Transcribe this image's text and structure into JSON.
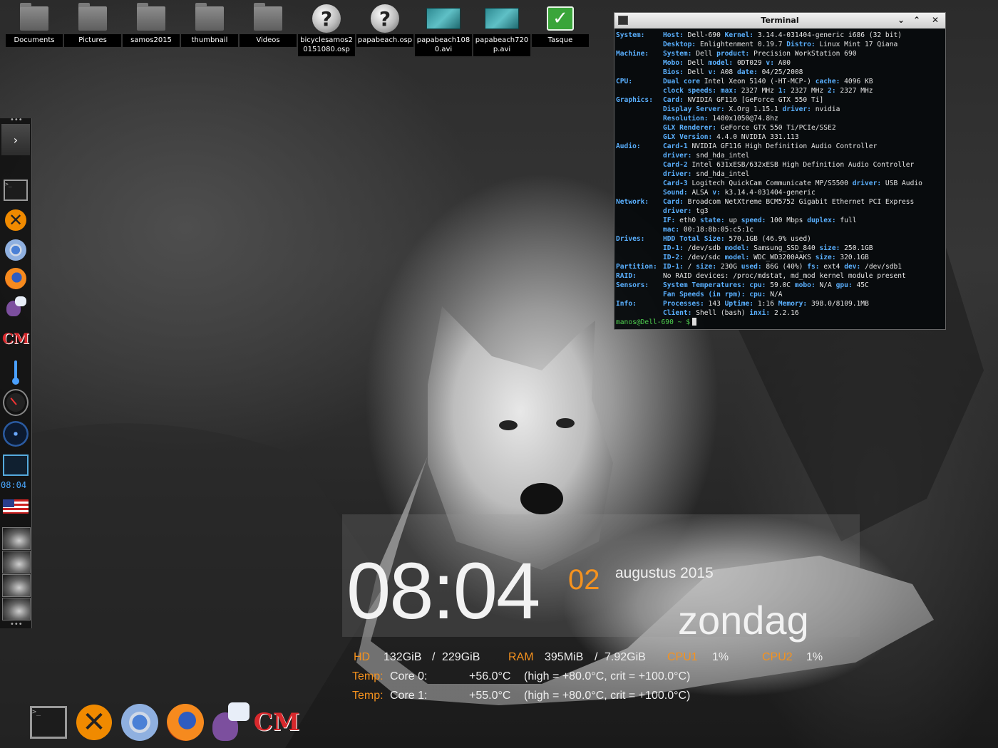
{
  "desktop_icons": [
    {
      "label": "Documents",
      "icon": "folder-icon"
    },
    {
      "label": "Pictures",
      "icon": "folder-icon"
    },
    {
      "label": "samos2015",
      "icon": "folder-icon"
    },
    {
      "label": "thumbnail",
      "icon": "folder-icon"
    },
    {
      "label": "Videos",
      "icon": "folder-icon"
    },
    {
      "label": "bicyclesamos20151080.osp",
      "icon": "unknown-file-icon"
    },
    {
      "label": "papabeach.osp",
      "icon": "unknown-file-icon"
    },
    {
      "label": "papabeach1080.avi",
      "icon": "video-file-icon"
    },
    {
      "label": "papabeach720p.avi",
      "icon": "video-file-icon"
    },
    {
      "label": "Tasque",
      "icon": "checkmark-icon"
    }
  ],
  "shelf": {
    "toggle_glyph": "›",
    "clock_text": "08:04",
    "launchers": [
      "terminal-icon",
      "xo-icon",
      "chrome-icon",
      "firefox-icon",
      "pidgin-icon",
      "cm-icon"
    ],
    "gadgets": [
      "thermometer-icon",
      "speedometer-icon",
      "disc-icon",
      "screen-icon"
    ]
  },
  "terminal": {
    "title": "Terminal",
    "lines": [
      {
        "sec": "System:",
        "parts": [
          [
            "k",
            "Host: "
          ],
          [
            "t",
            "Dell-690 "
          ],
          [
            "k",
            "Kernel: "
          ],
          [
            "t",
            "3.14.4-031404-generic i686 (32 bit)"
          ]
        ]
      },
      {
        "sec": "",
        "parts": [
          [
            "k",
            "Desktop: "
          ],
          [
            "t",
            "Enlightenment 0.19.7 "
          ],
          [
            "k",
            "Distro: "
          ],
          [
            "t",
            "Linux Mint 17 Qiana"
          ]
        ]
      },
      {
        "sec": "Machine:",
        "parts": [
          [
            "k",
            "System: "
          ],
          [
            "t",
            "Dell "
          ],
          [
            "k",
            "product: "
          ],
          [
            "t",
            "Precision WorkStation 690"
          ]
        ]
      },
      {
        "sec": "",
        "parts": [
          [
            "k",
            "Mobo: "
          ],
          [
            "t",
            "Dell "
          ],
          [
            "k",
            "model: "
          ],
          [
            "t",
            "0DT029 "
          ],
          [
            "k",
            "v: "
          ],
          [
            "t",
            "A00"
          ]
        ]
      },
      {
        "sec": "",
        "parts": [
          [
            "k",
            "Bios: "
          ],
          [
            "t",
            "Dell "
          ],
          [
            "k",
            "v: "
          ],
          [
            "t",
            "A08 "
          ],
          [
            "k",
            "date: "
          ],
          [
            "t",
            "04/25/2008"
          ]
        ]
      },
      {
        "sec": "CPU:",
        "parts": [
          [
            "k",
            "Dual core "
          ],
          [
            "t",
            "Intel Xeon 5140 (-HT-MCP-) "
          ],
          [
            "k",
            "cache: "
          ],
          [
            "t",
            "4096 KB"
          ]
        ]
      },
      {
        "sec": "",
        "parts": [
          [
            "k",
            "clock speeds: max: "
          ],
          [
            "t",
            "2327 MHz "
          ],
          [
            "k",
            "1: "
          ],
          [
            "t",
            "2327 MHz "
          ],
          [
            "k",
            "2: "
          ],
          [
            "t",
            "2327 MHz"
          ]
        ]
      },
      {
        "sec": "Graphics:",
        "parts": [
          [
            "k",
            "Card: "
          ],
          [
            "t",
            "NVIDIA GF116 [GeForce GTX 550 Ti]"
          ]
        ]
      },
      {
        "sec": "",
        "parts": [
          [
            "k",
            "Display Server: "
          ],
          [
            "t",
            "X.Org 1.15.1 "
          ],
          [
            "k",
            "driver: "
          ],
          [
            "t",
            "nvidia"
          ]
        ]
      },
      {
        "sec": "",
        "parts": [
          [
            "k",
            "Resolution: "
          ],
          [
            "t",
            "1400x1050@74.8hz"
          ]
        ]
      },
      {
        "sec": "",
        "parts": [
          [
            "k",
            "GLX Renderer: "
          ],
          [
            "t",
            "GeForce GTX 550 Ti/PCIe/SSE2"
          ]
        ]
      },
      {
        "sec": "",
        "parts": [
          [
            "k",
            "GLX Version: "
          ],
          [
            "t",
            "4.4.0 NVIDIA 331.113"
          ]
        ]
      },
      {
        "sec": "Audio:",
        "parts": [
          [
            "k",
            "Card-1 "
          ],
          [
            "t",
            "NVIDIA GF116 High Definition Audio Controller"
          ]
        ]
      },
      {
        "sec": "",
        "parts": [
          [
            "k",
            "driver: "
          ],
          [
            "t",
            "snd_hda_intel"
          ]
        ]
      },
      {
        "sec": "",
        "parts": [
          [
            "k",
            "Card-2 "
          ],
          [
            "t",
            "Intel 631xESB/632xESB High Definition Audio Controller"
          ]
        ]
      },
      {
        "sec": "",
        "parts": [
          [
            "k",
            "driver: "
          ],
          [
            "t",
            "snd_hda_intel"
          ]
        ]
      },
      {
        "sec": "",
        "parts": [
          [
            "k",
            "Card-3 "
          ],
          [
            "t",
            "Logitech QuickCam Communicate MP/S5500 "
          ],
          [
            "k",
            "driver: "
          ],
          [
            "t",
            "USB Audio"
          ]
        ]
      },
      {
        "sec": "",
        "parts": [
          [
            "k",
            "Sound: "
          ],
          [
            "t",
            "ALSA "
          ],
          [
            "k",
            "v: "
          ],
          [
            "t",
            "k3.14.4-031404-generic"
          ]
        ]
      },
      {
        "sec": "Network:",
        "parts": [
          [
            "k",
            "Card: "
          ],
          [
            "t",
            "Broadcom NetXtreme BCM5752 Gigabit Ethernet PCI Express"
          ]
        ]
      },
      {
        "sec": "",
        "parts": [
          [
            "k",
            "driver: "
          ],
          [
            "t",
            "tg3"
          ]
        ]
      },
      {
        "sec": "",
        "parts": [
          [
            "k",
            "IF: "
          ],
          [
            "t",
            "eth0 "
          ],
          [
            "k",
            "state: "
          ],
          [
            "t",
            "up "
          ],
          [
            "k",
            "speed: "
          ],
          [
            "t",
            "100 Mbps "
          ],
          [
            "k",
            "duplex: "
          ],
          [
            "t",
            "full"
          ]
        ]
      },
      {
        "sec": "",
        "parts": [
          [
            "k",
            "mac: "
          ],
          [
            "t",
            "00:18:8b:05:c5:1c"
          ]
        ]
      },
      {
        "sec": "Drives:",
        "parts": [
          [
            "k",
            "HDD Total Size: "
          ],
          [
            "t",
            "570.1GB (46.9% used)"
          ]
        ]
      },
      {
        "sec": "",
        "parts": [
          [
            "k",
            "ID-1: "
          ],
          [
            "t",
            "/dev/sdb "
          ],
          [
            "k",
            "model: "
          ],
          [
            "t",
            "Samsung_SSD_840 "
          ],
          [
            "k",
            "size: "
          ],
          [
            "t",
            "250.1GB"
          ]
        ]
      },
      {
        "sec": "",
        "parts": [
          [
            "k",
            "ID-2: "
          ],
          [
            "t",
            "/dev/sdc "
          ],
          [
            "k",
            "model: "
          ],
          [
            "t",
            "WDC_WD3200AAKS "
          ],
          [
            "k",
            "size: "
          ],
          [
            "t",
            "320.1GB"
          ]
        ]
      },
      {
        "sec": "Partition:",
        "parts": [
          [
            "k",
            "ID-1: "
          ],
          [
            "t",
            "/ "
          ],
          [
            "k",
            "size: "
          ],
          [
            "t",
            "230G "
          ],
          [
            "k",
            "used: "
          ],
          [
            "t",
            "86G (40%) "
          ],
          [
            "k",
            "fs: "
          ],
          [
            "t",
            "ext4 "
          ],
          [
            "k",
            "dev: "
          ],
          [
            "t",
            "/dev/sdb1"
          ]
        ]
      },
      {
        "sec": "RAID:",
        "parts": [
          [
            "t",
            "No RAID devices: /proc/mdstat, md_mod kernel module present"
          ]
        ]
      },
      {
        "sec": "Sensors:",
        "parts": [
          [
            "k",
            "System Temperatures: cpu: "
          ],
          [
            "t",
            "59.0C "
          ],
          [
            "k",
            "mobo: "
          ],
          [
            "t",
            "N/A "
          ],
          [
            "k",
            "gpu: "
          ],
          [
            "t",
            "45C"
          ]
        ]
      },
      {
        "sec": "",
        "parts": [
          [
            "k",
            "Fan Speeds (in rpm): cpu: "
          ],
          [
            "t",
            "N/A"
          ]
        ]
      },
      {
        "sec": "Info:",
        "parts": [
          [
            "k",
            "Processes: "
          ],
          [
            "t",
            "143 "
          ],
          [
            "k",
            "Uptime: "
          ],
          [
            "t",
            "1:16 "
          ],
          [
            "k",
            "Memory: "
          ],
          [
            "t",
            "398.0/8109.1MB"
          ]
        ]
      },
      {
        "sec": "",
        "parts": [
          [
            "k",
            "Client: "
          ],
          [
            "t",
            "Shell (bash) "
          ],
          [
            "k",
            "inxi: "
          ],
          [
            "t",
            "2.2.16"
          ]
        ]
      }
    ],
    "prompt": "manos@Dell-690 ~ $"
  },
  "conky": {
    "time": "08:04",
    "day": "02",
    "month_year": "augustus  2015",
    "weekday": "zondag",
    "hd_label": "HD",
    "hd_used": "132GiB",
    "hd_sep": "/",
    "hd_total": "229GiB",
    "ram_label": "RAM",
    "ram_used": "395MiB",
    "ram_sep": "/",
    "ram_total": "7.92GiB",
    "cpu1_label": "CPU1",
    "cpu1_value": "1%",
    "cpu2_label": "CPU2",
    "cpu2_value": "1%",
    "temp1_label": "Temp:",
    "temp1_core": "Core 0:",
    "temp1_value": "+56.0°C",
    "temp1_limits": "(high = +80.0°C, crit = +100.0°C)",
    "temp2_label": "Temp:",
    "temp2_core": "Core 1:",
    "temp2_value": "+55.0°C",
    "temp2_limits": "(high = +80.0°C, crit = +100.0°C)"
  },
  "dock": {
    "items": [
      "terminal-icon",
      "xo-icon",
      "chrome-icon",
      "firefox-icon",
      "pidgin-icon",
      "cm-icon"
    ]
  },
  "colors": {
    "accent_orange": "#f5921e",
    "terminal_key": "#5ab0ff",
    "prompt_green": "#4fd04f"
  }
}
